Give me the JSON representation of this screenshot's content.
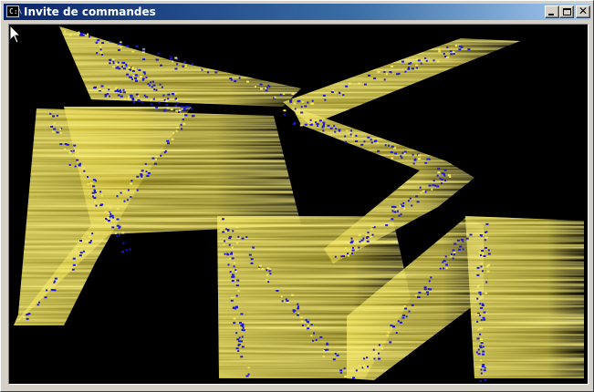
{
  "window": {
    "title": "Invite de commandes",
    "icon": "console-icon",
    "controls": [
      "minimize-icon",
      "maximize-icon",
      "close-icon"
    ]
  },
  "colors": {
    "background": "#000000",
    "ribbon": "#e2d43a",
    "speckle": "#1a1ad8",
    "titlebar": "#0a246a"
  },
  "cursor": "mouse-pointer-icon"
}
